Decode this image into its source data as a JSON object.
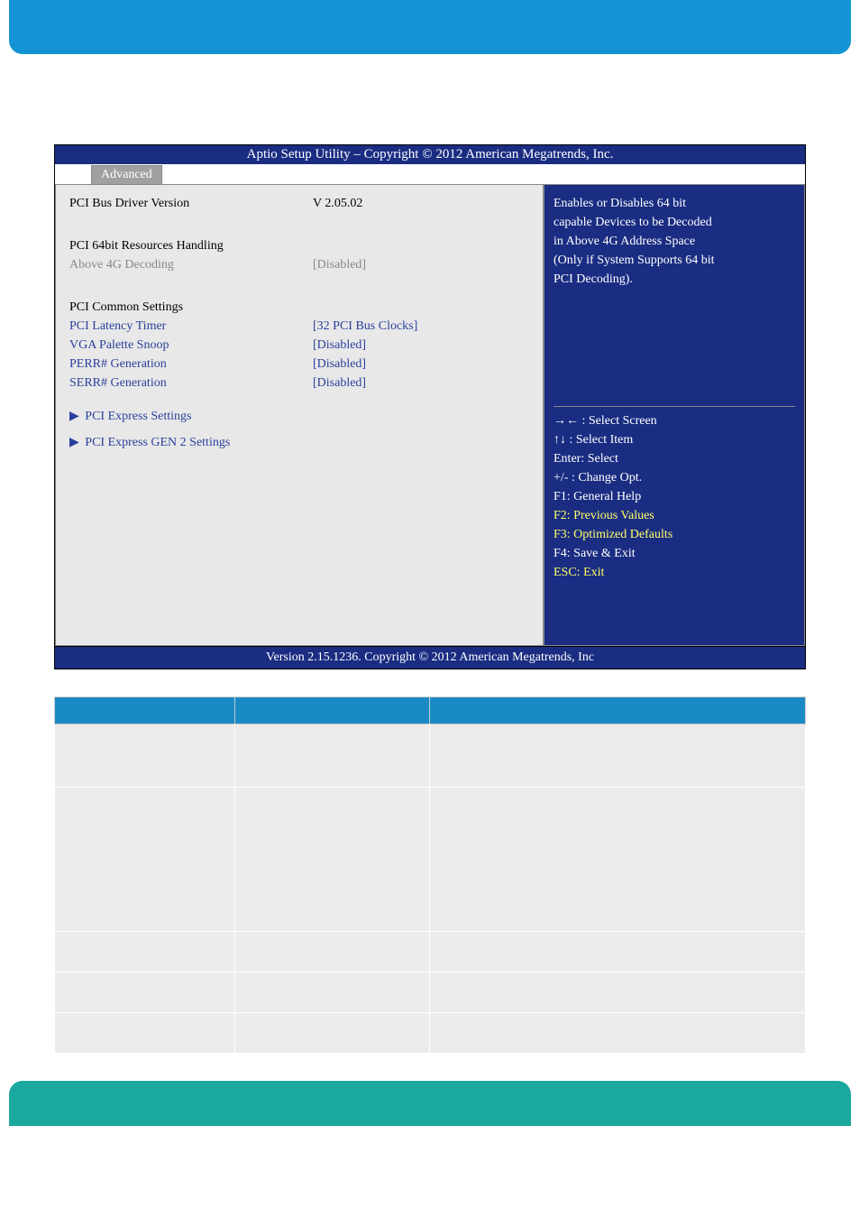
{
  "bios": {
    "title": "Aptio Setup Utility  –  Copyright © 2012 American Megatrends, Inc.",
    "tab": "Advanced",
    "rows": {
      "driver_ver_label": "PCI Bus Driver Version",
      "driver_ver_value": "V 2.05.02",
      "handling_heading": "PCI 64bit Resources Handling",
      "above4g_label": "Above 4G Decoding",
      "above4g_value": "[Disabled]",
      "common_heading": "PCI Common Settings",
      "latency_label": "PCI Latency Timer",
      "latency_value": "[32 PCI Bus Clocks]",
      "vga_label": "VGA Palette Snoop",
      "vga_value": "[Disabled]",
      "perr_label": "PERR# Generation",
      "perr_value": "[Disabled]",
      "serr_label": "SERR# Generation",
      "serr_value": "[Disabled]",
      "express_settings": "PCI Express Settings",
      "express_gen2": "PCI Express GEN 2 Settings"
    },
    "help": {
      "line1": "Enables or Disables 64 bit",
      "line2": "capable Devices to be Decoded",
      "line3": "in Above 4G Address Space",
      "line4": "(Only if System Supports 64 bit",
      "line5": "PCI Decoding).",
      "k1": "→← : Select Screen",
      "k2": "↑↓ : Select Item",
      "k3": "Enter: Select",
      "k4": "+/- : Change Opt.",
      "k5": "F1: General Help",
      "k6": "F2: Previous Values",
      "k7": "F3: Optimized Defaults",
      "k8": "F4: Save & Exit",
      "k9": "ESC: Exit"
    },
    "footer": "Version 2.15.1236. Copyright © 2012 American Megatrends, Inc"
  },
  "table": {
    "rows": [
      {
        "h": "70"
      },
      {
        "h": "160"
      },
      {
        "h": "45"
      },
      {
        "h": "45"
      },
      {
        "h": "45"
      }
    ]
  }
}
